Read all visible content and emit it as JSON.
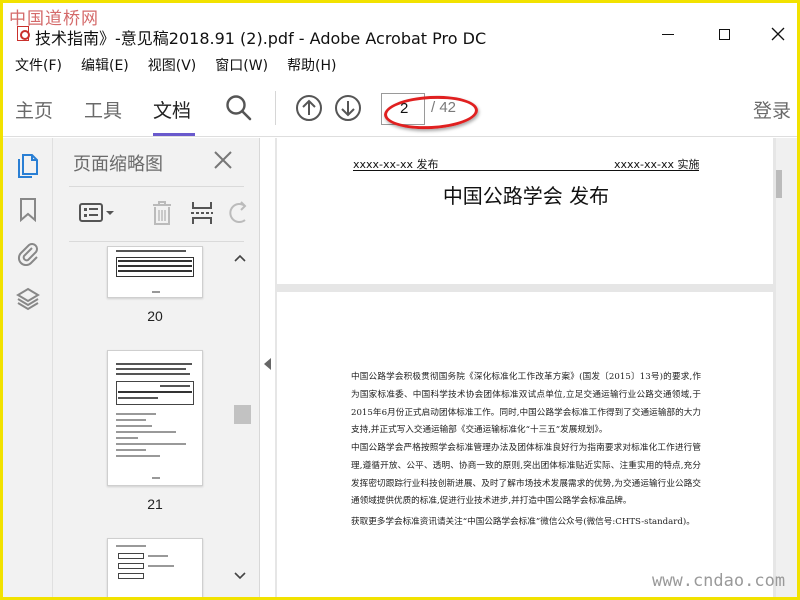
{
  "watermark": {
    "top_left": "中国道桥网",
    "bottom_right": "www.cndao.com"
  },
  "window": {
    "title": "技术指南》-意见稿2018.91 (2).pdf - Adobe Acrobat Pro DC"
  },
  "menu": [
    "文件(F)",
    "编辑(E)",
    "视图(V)",
    "窗口(W)",
    "帮助(H)"
  ],
  "toolbar": {
    "tabs": [
      "主页",
      "工具",
      "文档"
    ],
    "active_tab": "文档",
    "current_page": "2",
    "page_total": "/ 42",
    "signin": "登录"
  },
  "left_rail": {
    "icons": [
      "page-thumbnails-icon",
      "bookmark-icon",
      "attachment-icon",
      "layers-icon"
    ],
    "active_color": "#2a7fd4"
  },
  "thumbnails_panel": {
    "title": "页面缩略图",
    "pages": [
      {
        "label": "20"
      },
      {
        "label": "21"
      }
    ]
  },
  "document": {
    "page1": {
      "header_left": "xxxx-xx-xx 发布",
      "header_right": "xxxx-xx-xx 实施",
      "publisher": "中国公路学会  发布"
    },
    "page2": {
      "paragraphs": [
        "中国公路学会积极贯彻国务院《深化标准化工作改革方案》(国发〔2015〕13号)的要求,作为国家标准委、中国科学技术协会团体标准双试点单位,立足交通运输行业公路交通领域,于2015年6月份正式启动团体标准工作。同时,中国公路学会标准工作得到了交通运输部的大力支持,并正式写入交通运输部《交通运输标准化“十三五”发展规划》。",
        "中国公路学会严格按照学会标准管理办法及团体标准良好行为指南要求对标准化工作进行管理,遵循开放、公平、透明、协商一致的原则,突出团体标准贴近实际、注重实用的特点,充分发挥密切跟踪行业科技创新进展、及时了解市场技术发展需求的优势,为交通运输行业公路交通领域提供优质的标准,促进行业技术进步,并打造中国公路学会标准品牌。",
        "获取更多学会标准资讯请关注“中国公路学会标准”微信公众号(微信号:CHTS-standard)。"
      ]
    }
  },
  "colors": {
    "frame": "#f2e200",
    "annotation": "#e02020",
    "tab_underline": "#6a5acd"
  }
}
